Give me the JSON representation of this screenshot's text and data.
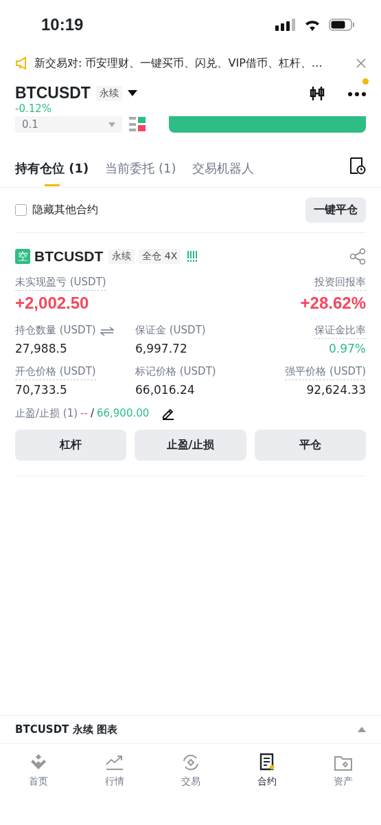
{
  "status_bar": {
    "time": "10:19"
  },
  "notice": {
    "text": "新交易对: 币安理财、一键买币、闪兑、VIP借币、杠杆、…"
  },
  "header": {
    "symbol": "BTCUSDT",
    "tag": "永续",
    "change": "-0.12%",
    "has_alert": true
  },
  "order_form": {
    "quantity": "0.1"
  },
  "tabs": [
    {
      "label": "持有仓位 (1)",
      "selected": true
    },
    {
      "label": "当前委托 (1)",
      "selected": false
    },
    {
      "label": "交易机器人",
      "selected": false
    }
  ],
  "filter": {
    "label": "隐藏其他合约",
    "checked": false
  },
  "close_all_button": "一键平仓",
  "position": {
    "side": "空",
    "symbol": "BTCUSDT",
    "tags": [
      "永续",
      "全仓 4X"
    ],
    "pnl_label": "未实现盈亏 (USDT)",
    "pnl_value": "+2,002.50",
    "roi_label": "投资回报率",
    "roi_value": "+28.62%",
    "fields": [
      {
        "label": "持仓数量 (USDT)",
        "value": "27,988.5",
        "underlined": false,
        "switchable": true,
        "positive": false
      },
      {
        "label": "保证金 (USDT)",
        "value": "6,997.72",
        "underlined": false,
        "switchable": false,
        "positive": false
      },
      {
        "label": "保证金比率",
        "value": "0.97%",
        "underlined": true,
        "switchable": false,
        "positive": true
      },
      {
        "label": "开仓价格 (USDT)",
        "value": "70,733.5",
        "underlined": true,
        "switchable": false,
        "positive": false
      },
      {
        "label": "标记价格 (USDT)",
        "value": "66,016.24",
        "underlined": false,
        "switchable": false,
        "positive": false
      },
      {
        "label": "强平价格 (USDT)",
        "value": "92,624.33",
        "underlined": true,
        "switchable": false,
        "positive": false
      }
    ],
    "tpsl": {
      "label": "止盈/止损 (1)",
      "take_profit": "--",
      "separator": "/",
      "stop_loss": "66,900.00"
    },
    "buttons": [
      "杠杆",
      "止盈/止损",
      "平仓"
    ]
  },
  "chart_bar": {
    "label": "BTCUSDT 永续 图表"
  },
  "nav": [
    {
      "label": "首页",
      "selected": false
    },
    {
      "label": "行情",
      "selected": false
    },
    {
      "label": "交易",
      "selected": false
    },
    {
      "label": "合约",
      "selected": true
    },
    {
      "label": "资产",
      "selected": false
    }
  ]
}
